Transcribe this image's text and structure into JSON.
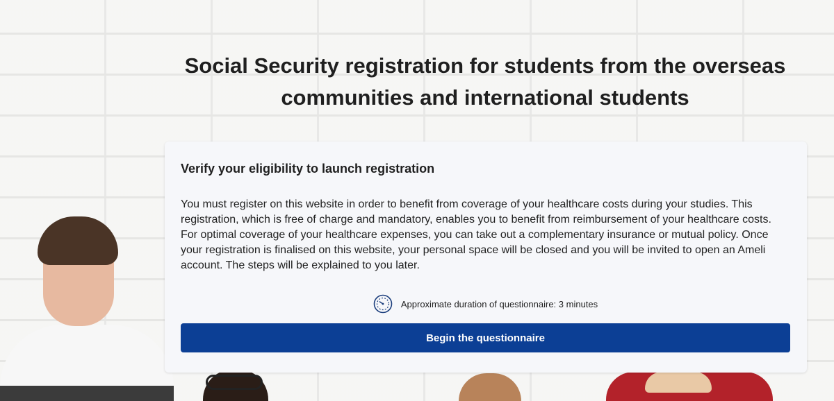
{
  "page": {
    "title": "Social Security registration for students from the overseas communities and international students"
  },
  "card": {
    "heading": "Verify your eligibility to launch registration",
    "body": "You must register on this website in order to benefit from coverage of your healthcare costs during your studies. This registration, which is free of charge and mandatory, enables you to benefit from reimbursement of your healthcare costs. For optimal coverage of your healthcare expenses, you can take out a complementary insurance or mutual policy. Once your registration is finalised on this website, your personal space will be closed and you will be invited to open an Ameli account. The steps will be explained to you later.",
    "duration_text": "Approximate duration of questionnaire: 3 minutes",
    "duration_icon": "timer-icon",
    "button_label": "Begin the questionnaire"
  },
  "colors": {
    "button": "#0c3f95",
    "icon": "#1a3d7c",
    "card_background": "#f6f7fa"
  }
}
